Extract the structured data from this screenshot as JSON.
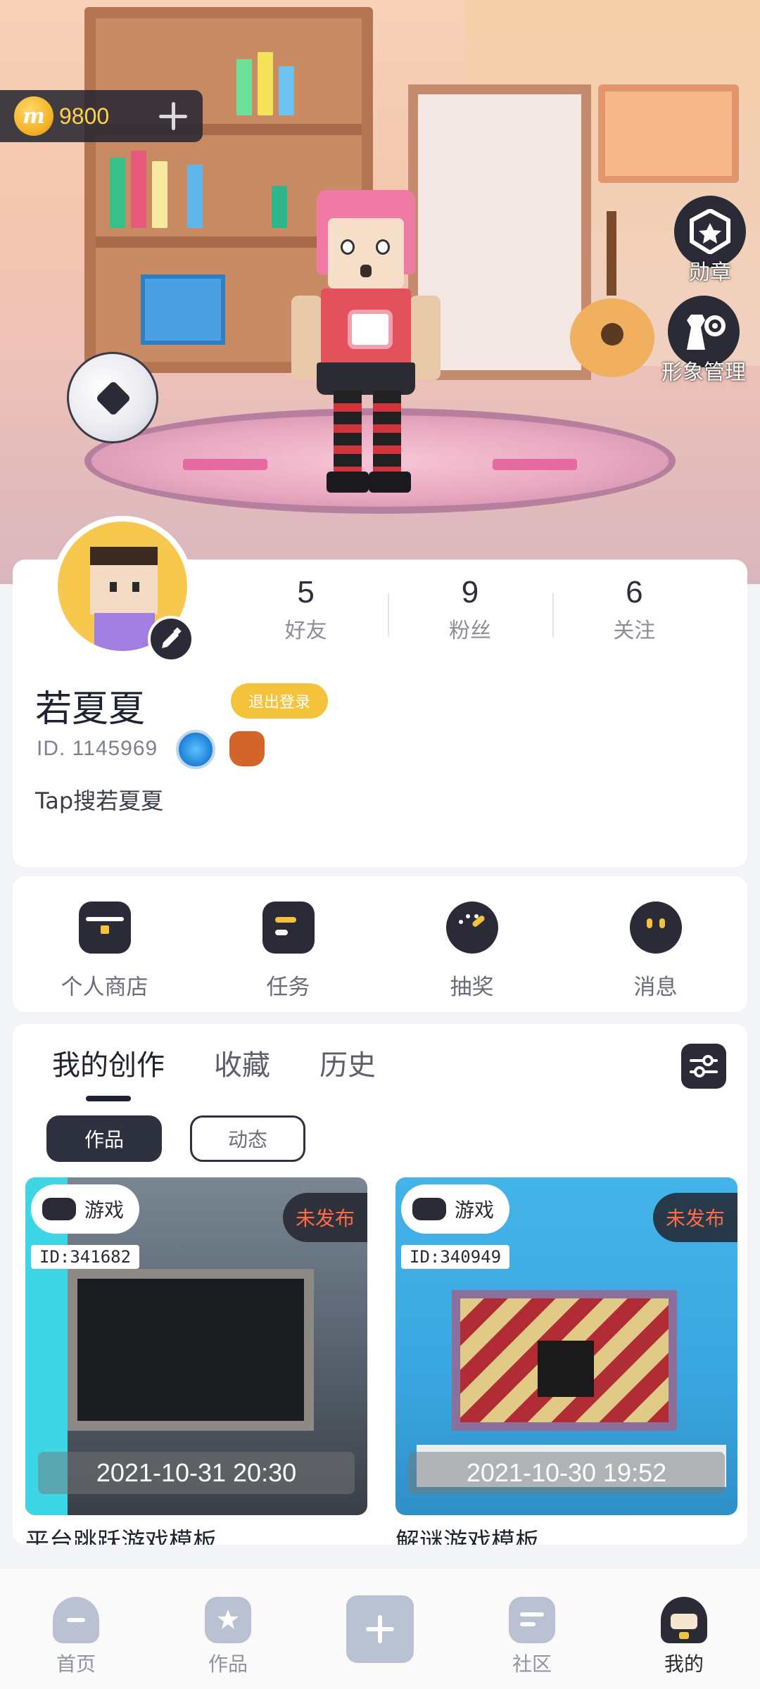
{
  "wallet": {
    "coin_symbol": "m",
    "amount": "9800"
  },
  "side_actions": {
    "medal_label": "勋章",
    "appearance_label": "形象管理"
  },
  "profile": {
    "stats": [
      {
        "value": "5",
        "label": "好友"
      },
      {
        "value": "9",
        "label": "粉丝"
      },
      {
        "value": "6",
        "label": "关注"
      }
    ],
    "username": "若夏夏",
    "logout_label": "退出登录",
    "user_id": "ID. 1145969",
    "bio": "Tap搜若夏夏"
  },
  "quick_actions": [
    {
      "label": "个人商店",
      "icon": "shop-bag-icon"
    },
    {
      "label": "任务",
      "icon": "task-icon"
    },
    {
      "label": "抽奖",
      "icon": "lottery-dial-icon"
    },
    {
      "label": "消息",
      "icon": "message-bubble-icon"
    }
  ],
  "creations": {
    "tabs": [
      "我的创作",
      "收藏",
      "历史"
    ],
    "active_tab": "我的创作",
    "chips": [
      "作品",
      "动态"
    ],
    "active_chip": "作品",
    "works": [
      {
        "type": "游戏",
        "status": "未发布",
        "id": "ID:341682",
        "date": "2021-10-31  20:30",
        "title": "平台跳跃游戏模板"
      },
      {
        "type": "游戏",
        "status": "未发布",
        "id": "ID:340949",
        "date": "2021-10-30  19:52",
        "title": "解谜游戏模板"
      }
    ]
  },
  "bottom_nav": [
    {
      "label": "首页",
      "icon": "home-icon"
    },
    {
      "label": "作品",
      "icon": "works-bookmark-icon"
    },
    {
      "label": "社区",
      "icon": "community-chat-icon"
    },
    {
      "label": "我的",
      "icon": "profile-avatar-icon"
    }
  ],
  "colors": {
    "accent_yellow": "#f5c33b",
    "dark": "#2a2b36",
    "status_red": "#ff6a4a",
    "coin_text": "#ffd24a"
  }
}
